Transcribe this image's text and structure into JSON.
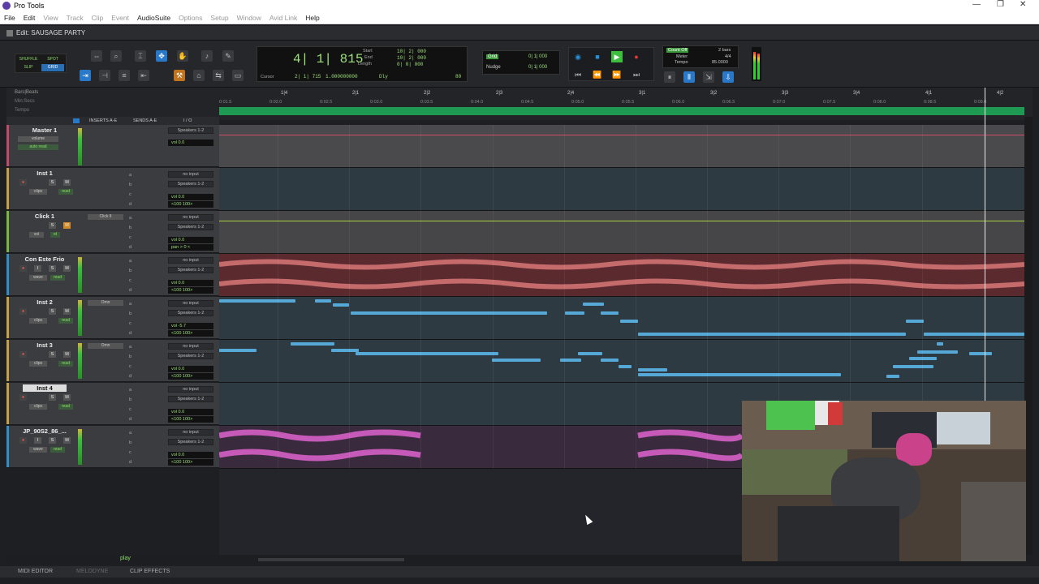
{
  "app": {
    "title": "Pro Tools"
  },
  "window_controls": {
    "minimize": "—",
    "maximize": "❐",
    "close": "✕"
  },
  "menu": [
    "File",
    "Edit",
    "View",
    "Track",
    "Clip",
    "Event",
    "AudioSuite",
    "Options",
    "Setup",
    "Window",
    "Avid Link",
    "Help"
  ],
  "edit_window": {
    "title": "Edit: SAUSAGE PARTY"
  },
  "edit_modes": {
    "shuffle": "SHUFFLE",
    "spot": "SPOT",
    "slip": "SLIP",
    "grid": "GRID"
  },
  "counter": {
    "main": "4| 1| 815",
    "cursor_label": "Cursor",
    "cursor_value": "2| 1| 715",
    "cursor_value2": "1.000000000",
    "start_label": "Start",
    "end_label": "End",
    "length_label": "Length",
    "start": "10| 2| 000",
    "end": "10| 2| 000",
    "length": "0| 0| 000",
    "dly": "Dly",
    "pre": "80"
  },
  "grid": {
    "grid_label": "Grid",
    "grid_value": "0| 1| 000",
    "nudge_label": "Nudge",
    "nudge_value": "0| 1| 000"
  },
  "countoff": {
    "count_off": "Count Off",
    "meter_label": "Meter",
    "tempo_label": "Tempo",
    "bars": "2 bars",
    "meter": "4/4",
    "tempo": "85.0000"
  },
  "ruler": {
    "bars_label": "Bars|Beats",
    "minsecs_label": "Min:Secs",
    "tempo_label": "Tempo",
    "bars": [
      "1|4",
      "2|1",
      "2|2",
      "2|3",
      "2|4",
      "3|1",
      "3|2",
      "3|3",
      "3|4",
      "4|1",
      "4|2"
    ],
    "minsecs": [
      "0:01.5",
      "0:02.0",
      "0:02.5",
      "0:03.0",
      "0:03.5",
      "0:04.0",
      "0:04.5",
      "0:05.0",
      "0:05.5",
      "0:06.0",
      "0:06.5",
      "0:07.0",
      "0:07.5",
      "0:08.0",
      "0:08.5",
      "0:09.0"
    ]
  },
  "columns": {
    "inserts": "INSERTS A-E",
    "sends": "SENDS A-E",
    "io": "I / O"
  },
  "tracks": [
    {
      "name": "Master 1",
      "color": "#c44a6a",
      "view1": "volume",
      "view2": "auto read",
      "io1": "Speakers 1-2",
      "vol": "vol     0.0"
    },
    {
      "name": "Inst 1",
      "color": "#c8a040",
      "view1": "clips",
      "view2": "read",
      "io1": "no input",
      "io2": "Speakers 1-2",
      "vol": "vol     0.0",
      "pan": "<100  100>",
      "inserts": "",
      "sends": [
        "a",
        "b",
        "c",
        "d"
      ]
    },
    {
      "name": "Click 1",
      "color": "#78b83a",
      "view1": "vol",
      "view2": "rd",
      "io1": "no input",
      "io2": "Speakers 1-2",
      "vol": "vol     0.0",
      "pan": "pan   > 0 <",
      "inserts": "Click II",
      "sends": [
        "a",
        "b",
        "c",
        "d"
      ]
    },
    {
      "name": "Con Este Frio",
      "color": "#2d8fc8",
      "view1": "wave",
      "view2": "read",
      "io1": "no input",
      "io2": "Speakers 1-2",
      "vol": "vol     0.0",
      "pan": "<100  100>",
      "sends": [
        "a",
        "b",
        "c",
        "d"
      ]
    },
    {
      "name": "Inst 2",
      "color": "#c8a040",
      "view1": "clips",
      "view2": "read",
      "io1": "no input",
      "io2": "Speakers 1-2",
      "vol": "vol    -5.7",
      "pan": "<100  100>",
      "inserts": "Omn",
      "sends": [
        "a",
        "b",
        "c",
        "d"
      ]
    },
    {
      "name": "Inst 3",
      "color": "#c8a040",
      "view1": "clips",
      "view2": "read",
      "io1": "no input",
      "io2": "Speakers 1-2",
      "vol": "vol     0.0",
      "pan": "<100  100>",
      "inserts": "Omn",
      "sends": [
        "a",
        "b",
        "c",
        "d"
      ]
    },
    {
      "name": "Inst 4",
      "color": "#c8a040",
      "view1": "clips",
      "view2": "read",
      "io1": "no input",
      "io2": "Speakers 1-2",
      "vol": "vol     0.0",
      "pan": "<100  100>",
      "sends": [
        "a",
        "b",
        "c",
        "d"
      ]
    },
    {
      "name": "JP_90S2_86_...",
      "color": "#2d8fc8",
      "view1": "wave",
      "view2": "read",
      "io1": "no input",
      "io2": "Speakers 1-2",
      "vol": "vol     0.0",
      "pan": "<100  100>",
      "sends": [
        "a",
        "b",
        "c",
        "d"
      ]
    }
  ],
  "track_buttons": {
    "rec": "●",
    "input": "I",
    "solo": "S",
    "mute": "M",
    "playlist": "p"
  },
  "status": {
    "play": "play"
  },
  "bottom_tabs": {
    "midi_editor": "MIDI EDITOR",
    "melodyne": "MELODYNE",
    "clip_effects": "CLIP EFFECTS"
  },
  "icons": {
    "zoom": "magnifier-icon",
    "trim": "trim-icon",
    "selector": "selector-icon",
    "grabber": "hand-icon",
    "scrub": "scrub-icon",
    "pencil": "pencil-icon"
  },
  "colors": {
    "tempo_ruler": "#1f9a52",
    "midi_note": "#56a9d6",
    "audio_red": "#b84a4a",
    "audio_magenta": "#b04aa8"
  }
}
